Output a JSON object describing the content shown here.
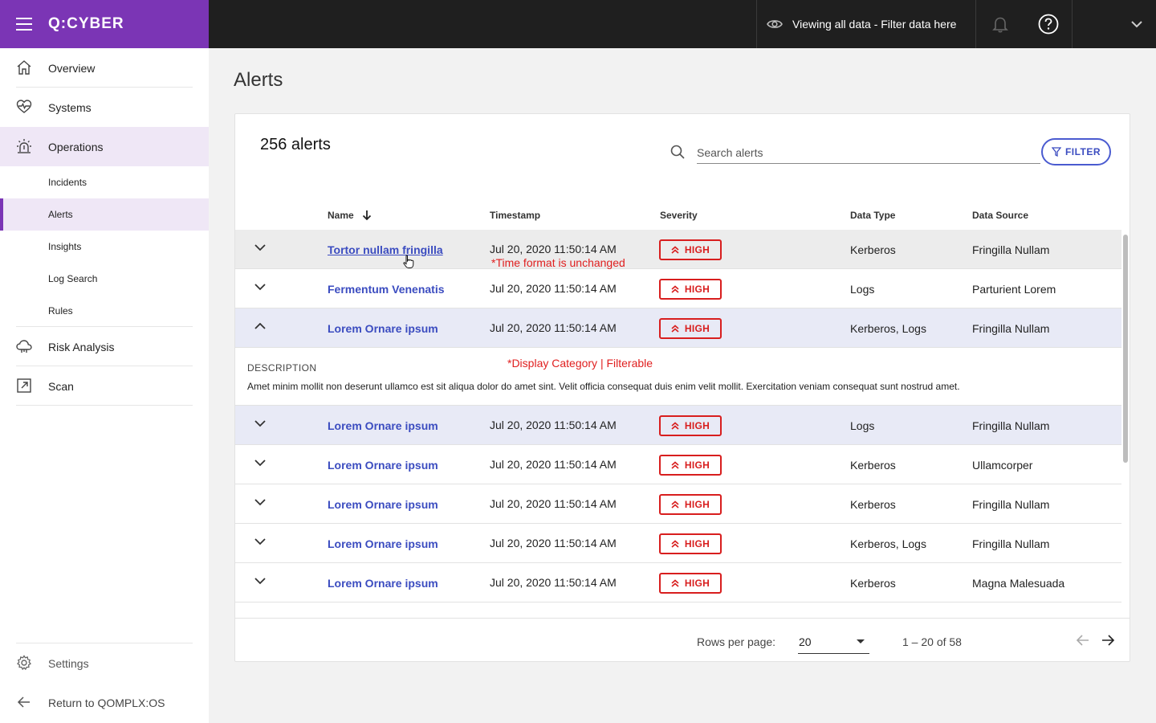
{
  "brand": {
    "logo": "Q:CYBER",
    "accent": "#7b35b5"
  },
  "topbar": {
    "viewing_text": "Viewing all data - Filter data here"
  },
  "sidebar": {
    "items": [
      {
        "label": "Overview",
        "icon": "home-icon"
      },
      {
        "label": "Systems",
        "icon": "heartbeat-icon"
      },
      {
        "label": "Operations",
        "icon": "alarm-icon"
      }
    ],
    "sub_items": [
      "Incidents",
      "Alerts",
      "Insights",
      "Log Search",
      "Rules"
    ],
    "items2": [
      {
        "label": "Risk Analysis",
        "icon": "cloud-icon"
      },
      {
        "label": "Scan",
        "icon": "external-link-icon"
      }
    ],
    "settings_label": "Settings",
    "return_label": "Return to QOMPLX:OS"
  },
  "page": {
    "title": "Alerts"
  },
  "card": {
    "count": "256 alerts",
    "search_placeholder": "Search alerts",
    "filter_label": "FILTER"
  },
  "table": {
    "headers": [
      "Name",
      "Timestamp",
      "Severity",
      "Data Type",
      "Data Source"
    ],
    "rows": [
      {
        "name": "Tortor nullam fringilla",
        "timestamp": "Jul 20, 2020 11:50:14 AM",
        "severity": "HIGH",
        "data_type": "Kerberos",
        "data_source": "Fringilla Nullam"
      },
      {
        "name": "Fermentum Venenatis",
        "timestamp": "Jul 20, 2020 11:50:14 AM",
        "severity": "HIGH",
        "data_type": "Logs",
        "data_source": "Parturient Lorem"
      },
      {
        "name": "Lorem Ornare ipsum",
        "timestamp": "Jul 20, 2020 11:50:14 AM",
        "severity": "HIGH",
        "data_type": "Kerberos, Logs",
        "data_source": "Fringilla Nullam"
      },
      {
        "name": "Lorem Ornare ipsum",
        "timestamp": "Jul 20, 2020 11:50:14 AM",
        "severity": "HIGH",
        "data_type": "Logs",
        "data_source": "Fringilla Nullam"
      },
      {
        "name": "Lorem Ornare ipsum",
        "timestamp": "Jul 20, 2020 11:50:14 AM",
        "severity": "HIGH",
        "data_type": "Kerberos",
        "data_source": "Ullamcorper"
      },
      {
        "name": "Lorem Ornare ipsum",
        "timestamp": "Jul 20, 2020 11:50:14 AM",
        "severity": "HIGH",
        "data_type": "Kerberos",
        "data_source": "Fringilla Nullam"
      },
      {
        "name": "Lorem Ornare ipsum",
        "timestamp": "Jul 20, 2020 11:50:14 AM",
        "severity": "HIGH",
        "data_type": "Kerberos, Logs",
        "data_source": "Fringilla Nullam"
      },
      {
        "name": "Lorem Ornare ipsum",
        "timestamp": "Jul 20, 2020 11:50:14 AM",
        "severity": "HIGH",
        "data_type": "Kerberos",
        "data_source": "Magna Malesuada"
      }
    ],
    "expanded": {
      "title": "DESCRIPTION",
      "text": "Amet minim mollit non deserunt ullamco est sit aliqua dolor do amet sint. Velit officia consequat duis enim velit mollit. Exercitation veniam consequat sunt nostrud amet."
    }
  },
  "annotations": {
    "time_note": "*Time format is unchanged",
    "category_note": "*Display Category | Filterable"
  },
  "pagination": {
    "rows_per_page_label": "Rows per page:",
    "rows_per_page_value": "20",
    "range": "1 – 20 of 58"
  },
  "colors": {
    "link": "#3b4cc0",
    "severity_high": "#d81e1e",
    "annotation": "#e01f1f"
  }
}
